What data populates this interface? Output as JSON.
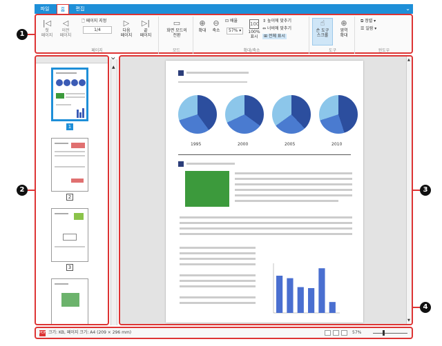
{
  "tabs": {
    "file": "파일",
    "home": "홈",
    "edit": "편집"
  },
  "ribbon": {
    "first_page": "첫\n페이지",
    "prev_page": "이전\n페이지",
    "page_specify": "페이지 지정",
    "page_value": "1/4",
    "next_page": "다음\n페이지",
    "last_page": "끝\n페이지",
    "group_page": "페이지",
    "screen_mode": "화면 모드의\n전환",
    "group_mode": "모드",
    "zoom_in": "확대",
    "zoom_out": "축소",
    "magnification": "배율",
    "zoom_value": "57%",
    "actual_100": "100%\n표시",
    "fit_height": "높이에 맞추기",
    "fit_width": "너비에 맞추기",
    "fit_all": "전체 표시",
    "group_zoom": "확대/축소",
    "hand_tool": "손 도구\n스크롤",
    "area_zoom": "영역\n확대",
    "group_tools": "도구",
    "arrange": "정렬",
    "list": "일람",
    "group_window": "윈도우"
  },
  "thumbnails": [
    {
      "num": "1",
      "selected": true
    },
    {
      "num": "2",
      "selected": false
    },
    {
      "num": "3",
      "selected": false
    }
  ],
  "document": {
    "years": [
      "1995",
      "2000",
      "2005",
      "2010"
    ],
    "chart_data": {
      "type": "bar",
      "values": [
        75,
        70,
        52,
        50,
        90,
        22
      ],
      "ylim": [
        0,
        100
      ]
    }
  },
  "status": {
    "size_text": "크기: KB, 페이지 크기: A4 (209 × 296 mm)",
    "zoom": "57%"
  },
  "callouts": [
    "1",
    "2",
    "3",
    "4"
  ]
}
